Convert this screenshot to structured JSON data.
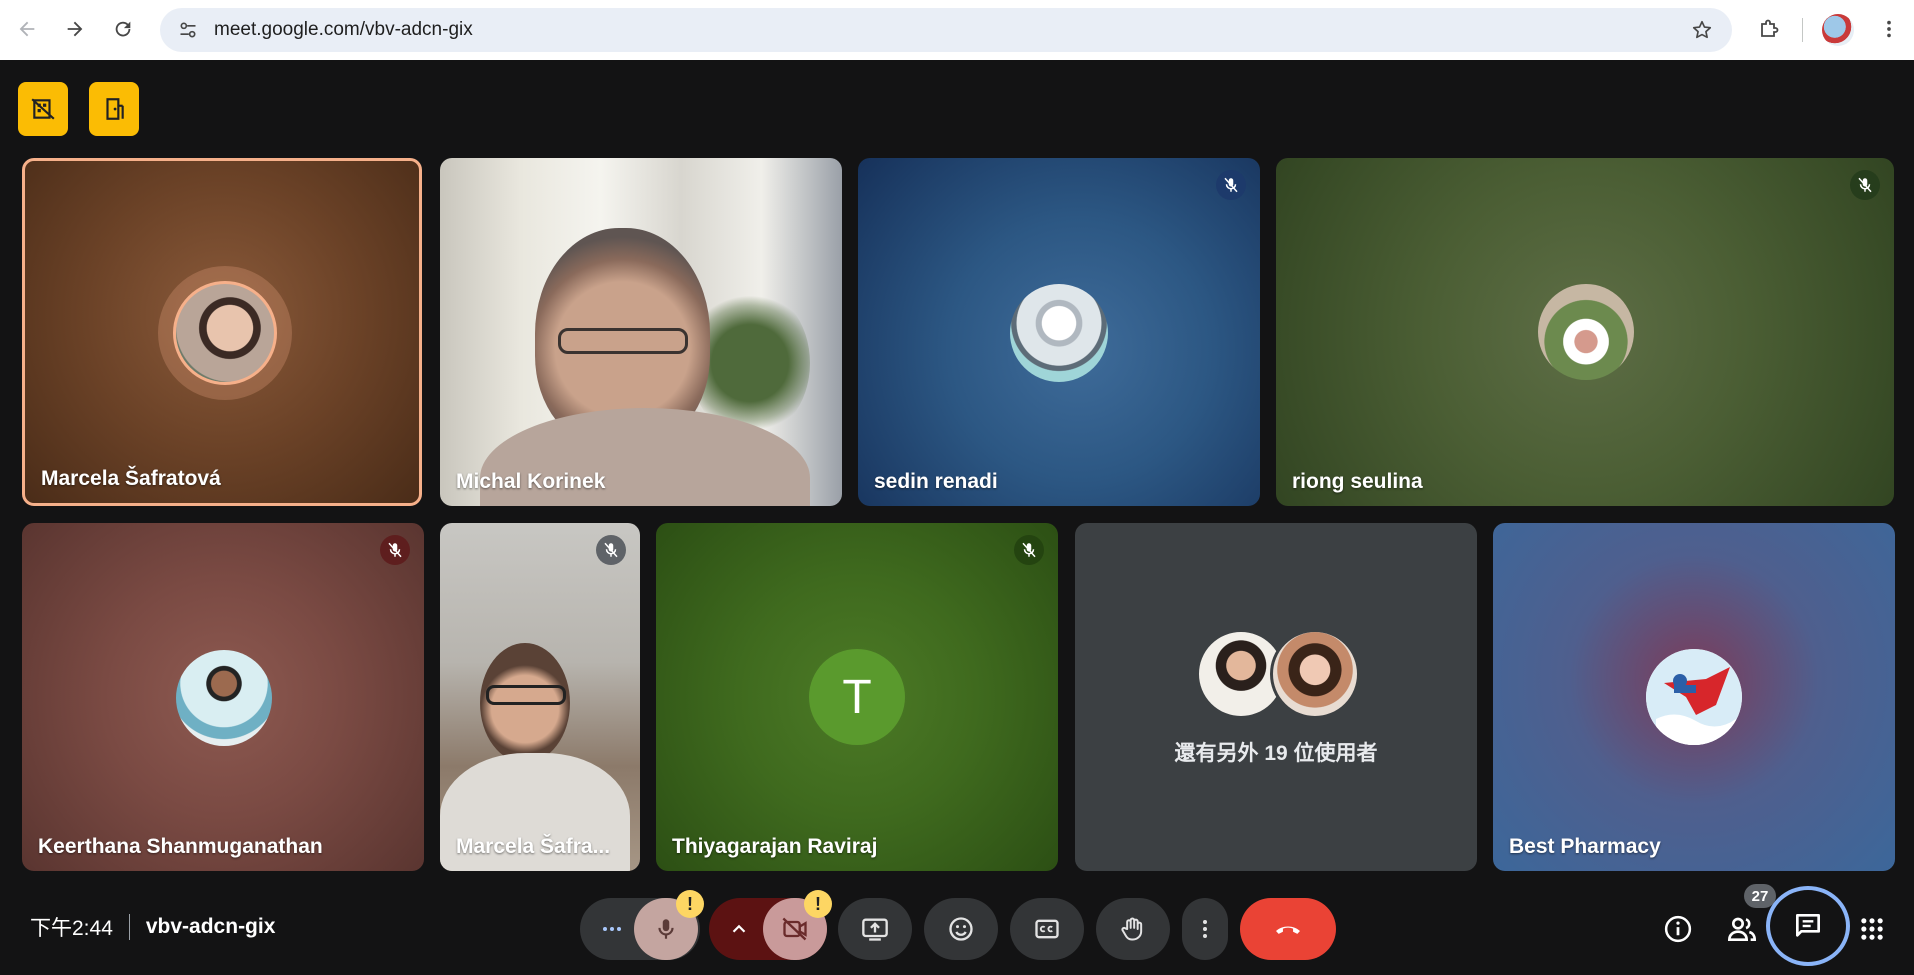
{
  "browser": {
    "url": "meet.google.com/vbv-adcn-gix"
  },
  "participants": [
    {
      "name": "Marcela Šafratová",
      "muted": false,
      "active_speaker": true
    },
    {
      "name": "Michal Korinek",
      "muted": false
    },
    {
      "name": "sedin renadi",
      "muted": true
    },
    {
      "name": "riong seulina",
      "muted": true
    },
    {
      "name": "Keerthana Shanmuganathan",
      "muted": true
    },
    {
      "name": "Marcela Šafra...",
      "muted": true
    },
    {
      "name": "Thiyagarajan Raviraj",
      "muted": true,
      "initial": "T"
    },
    {
      "name": "Best Pharmacy",
      "muted": false
    }
  ],
  "others_tile": {
    "label": "還有另外 19 位使用者"
  },
  "bottom_bar": {
    "time": "下午2:44",
    "meeting_code": "vbv-adcn-gix",
    "people_count": "27",
    "mic_warning": "!",
    "camera_warning": "!"
  },
  "colors": {
    "background": "#131314",
    "end_call": "#ea4335",
    "warning": "#fbbc04",
    "active_speaker_border": "#f6b08a",
    "chat_ring": "#8ab4f8"
  }
}
